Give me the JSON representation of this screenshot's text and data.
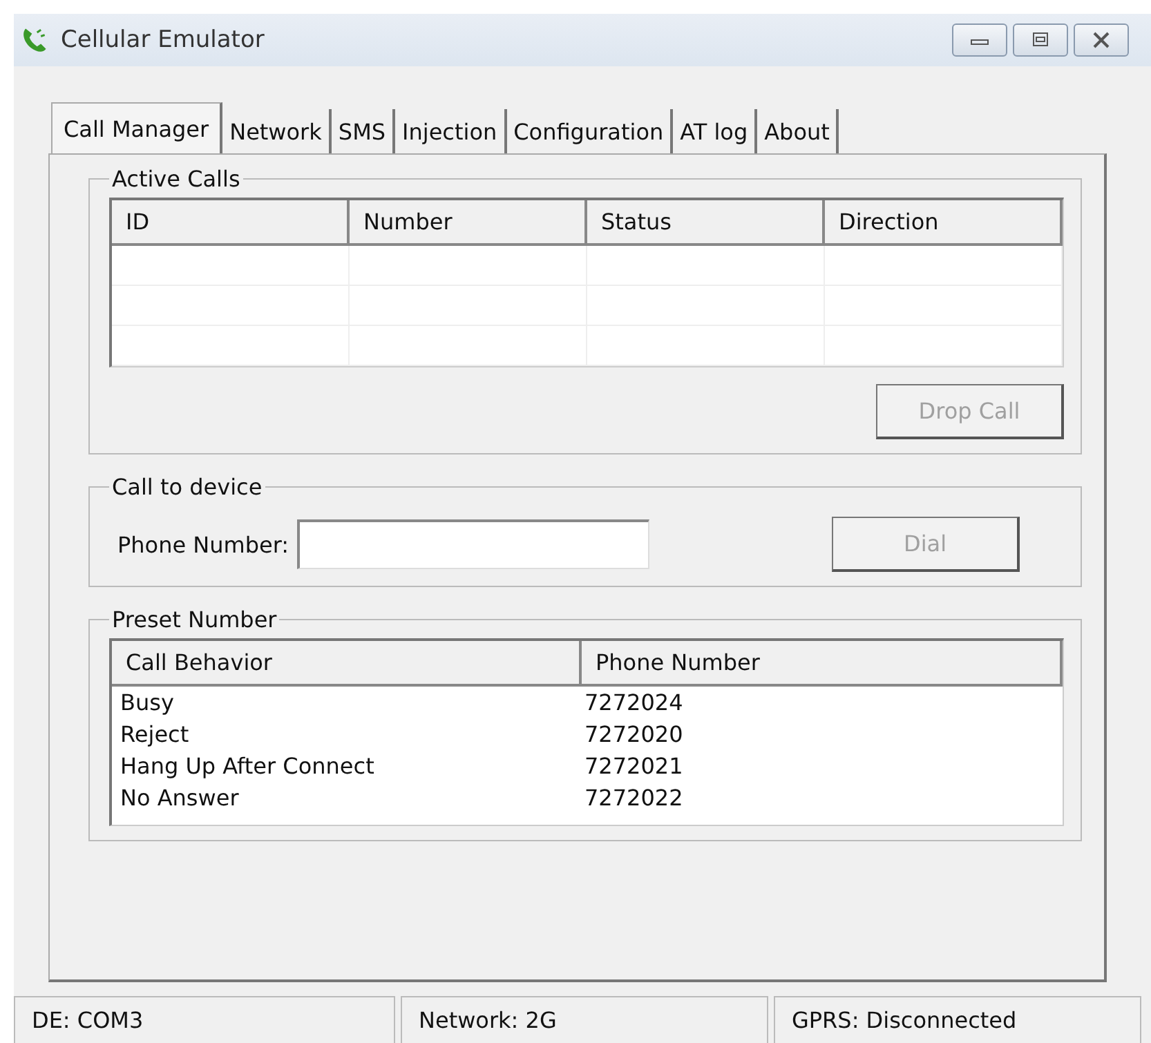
{
  "window": {
    "title": "Cellular Emulator"
  },
  "tabs": [
    {
      "label": "Call Manager",
      "selected": true
    },
    {
      "label": "Network",
      "selected": false
    },
    {
      "label": "SMS",
      "selected": false
    },
    {
      "label": "Injection",
      "selected": false
    },
    {
      "label": "Configuration",
      "selected": false
    },
    {
      "label": "AT log",
      "selected": false
    },
    {
      "label": "About",
      "selected": false
    }
  ],
  "active_calls": {
    "title": "Active Calls",
    "columns": [
      "ID",
      "Number",
      "Status",
      "Direction"
    ],
    "button": {
      "label": "Drop Call",
      "disabled": true
    }
  },
  "call_to_device": {
    "title": "Call to device",
    "label": "Phone Number:",
    "button": {
      "label": "Dial",
      "disabled": true
    }
  },
  "preset_number": {
    "title": "Preset Number",
    "columns": [
      "Call Behavior",
      "Phone Number"
    ],
    "rows": [
      [
        "Busy",
        "7272024"
      ],
      [
        "Reject",
        "7272020"
      ],
      [
        "Hang Up After Connect",
        "7272021"
      ],
      [
        "No Answer",
        "7272022"
      ]
    ]
  },
  "status_bar": [
    "DE: COM3",
    "Network: 2G",
    "GPRS: Disconnected"
  ]
}
